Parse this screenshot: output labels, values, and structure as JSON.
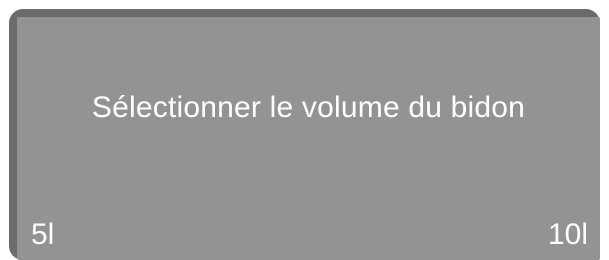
{
  "display": {
    "prompt": "Sélectionner le volume du bidon",
    "options": {
      "left": "5l",
      "right": "10l"
    }
  },
  "colors": {
    "bezel": "#6b6b6b",
    "screen": "#939393",
    "text": "#ffffff"
  }
}
